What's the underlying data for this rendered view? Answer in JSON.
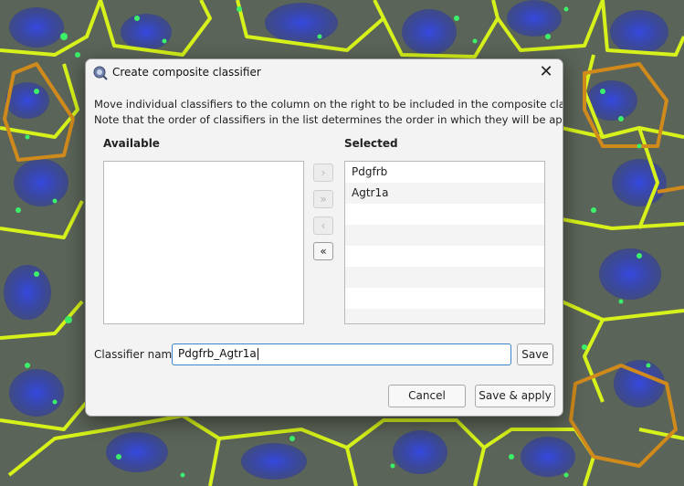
{
  "dialog": {
    "title": "Create composite classifier",
    "close_glyph": "✕",
    "description_lines": [
      "Move individual classifiers to the column on the right to be included in the composite classifier.",
      "Note that the order of classifiers in the list determines the order in which they will be applied."
    ],
    "available_header": "Available",
    "selected_header": "Selected",
    "available_items": [],
    "selected_items": [
      "Pdgfrb",
      "Agtr1a"
    ],
    "move_buttons": [
      {
        "glyph": "›",
        "enabled": false
      },
      {
        "glyph": "»",
        "enabled": false
      },
      {
        "glyph": "‹",
        "enabled": false
      },
      {
        "glyph": "«",
        "enabled": true
      }
    ],
    "name_label": "Classifier name",
    "name_value": "Pdgfrb_Agtr1a",
    "save_label": "Save",
    "cancel_label": "Cancel",
    "save_apply_label": "Save & apply"
  },
  "icons": {
    "app": "qupath-app-icon",
    "close": "close-icon"
  },
  "background": {
    "description": "",
    "cell_outline_color": "#d6f21a",
    "highlight_outline_color": "#d08a1c",
    "nucleus_color": "#2b3fd0",
    "spot_color": "#3cf06a"
  }
}
